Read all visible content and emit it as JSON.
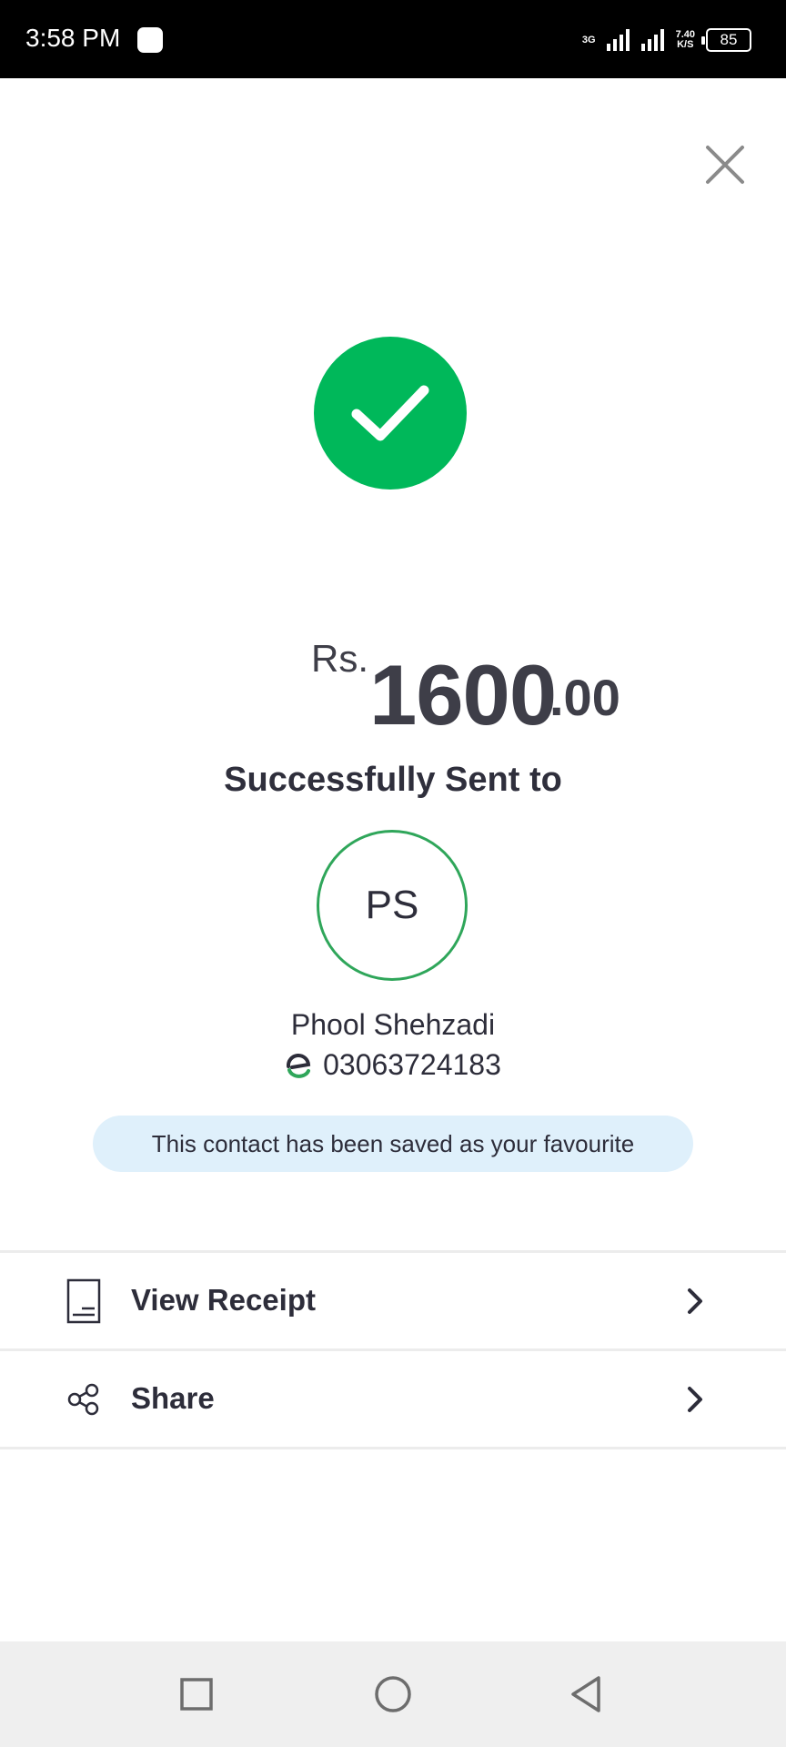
{
  "status_bar": {
    "time": "3:58 PM",
    "network_type": "3G",
    "speed_value": "7.40",
    "speed_unit": "K/S",
    "battery": "85"
  },
  "payment": {
    "currency": "Rs.",
    "amount_integer": "1600",
    "amount_decimal": ".00",
    "status_text": "Successfully Sent to"
  },
  "recipient": {
    "initials": "PS",
    "name": "Phool Shehzadi",
    "phone": "03063724183"
  },
  "favourite_banner": "This contact has been saved as your favourite",
  "actions": [
    {
      "label": "View Receipt",
      "icon": "receipt-icon"
    },
    {
      "label": "Share",
      "icon": "share-icon"
    }
  ],
  "colors": {
    "success": "#00b85a",
    "avatar_border": "#2fa65a",
    "banner_bg": "#dff0fb"
  }
}
